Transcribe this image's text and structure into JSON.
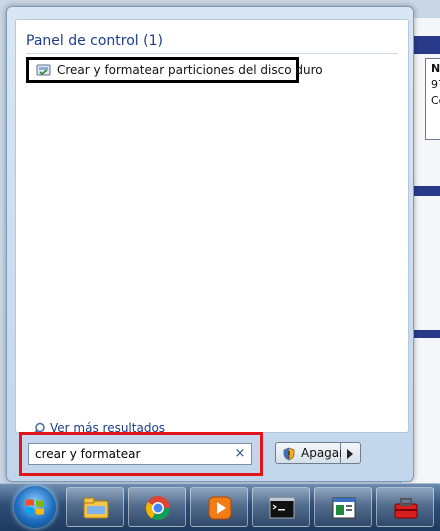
{
  "results": {
    "heading": "Panel de control (1)",
    "item_label": "Crear y formatear particiones del disco duro",
    "see_more_label": "Ver más resultados"
  },
  "search": {
    "value": "crear y formatear",
    "clear_symbol": "×"
  },
  "power": {
    "label": "Apagar"
  },
  "background_window": {
    "text_1": "N",
    "text_2": "97",
    "text_3": "Co"
  },
  "taskbar": {
    "items": [
      {
        "icon": "explorer-icon"
      },
      {
        "icon": "chrome-icon"
      },
      {
        "icon": "media-player-icon"
      },
      {
        "icon": "cmd-icon"
      },
      {
        "icon": "window-icon"
      },
      {
        "icon": "toolbox-icon"
      }
    ]
  },
  "colors": {
    "highlight_black": "#000000",
    "highlight_red": "#e0141b",
    "link_blue": "#1e3d8c"
  }
}
